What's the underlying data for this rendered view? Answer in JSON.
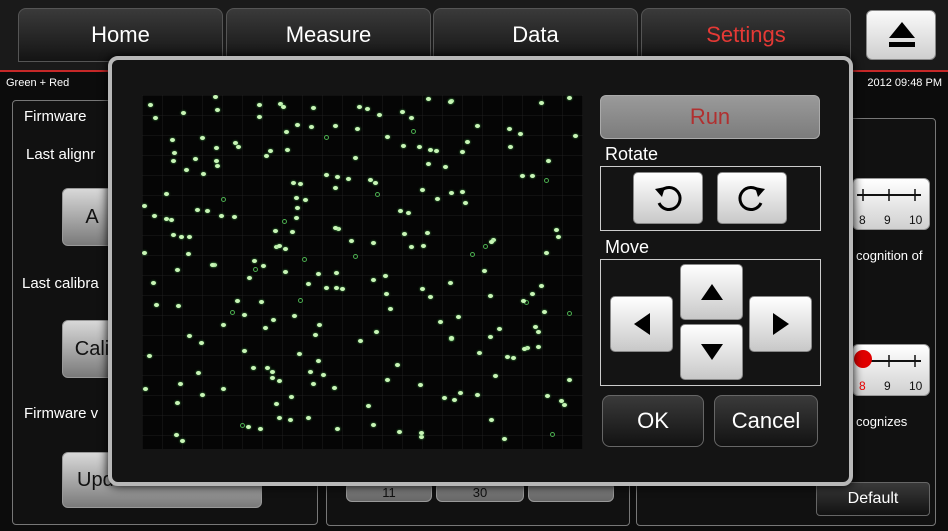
{
  "tabs": [
    {
      "label": "Home",
      "active": false
    },
    {
      "label": "Measure",
      "active": false
    },
    {
      "label": "Data",
      "active": false
    },
    {
      "label": "Settings",
      "active": true
    }
  ],
  "status": {
    "left": "Green + Red",
    "right": "2012  09:48 PM"
  },
  "background": {
    "firmware_label": "Firmware",
    "last_alignment": "Last alignr",
    "align_btn": "A",
    "last_calibration": "Last calibra",
    "calib_btn": "Cali",
    "firmware_version": "Firmware v",
    "update_btn": "Update firmware",
    "scale1_labels": [
      "8",
      "9",
      "10"
    ],
    "recognition_text": "cognition of",
    "scale2_labels": [
      "8",
      "9",
      "10"
    ],
    "recognizes_text": "cognizes",
    "bottom_values": [
      "11",
      "30"
    ],
    "default_btn": "Default"
  },
  "dialog": {
    "run_label": "Run",
    "rotate_label": "Rotate",
    "move_label": "Move",
    "ok_label": "OK",
    "cancel_label": "Cancel"
  },
  "colors": {
    "accent": "#e53935",
    "bead": "#c9f6b7"
  }
}
